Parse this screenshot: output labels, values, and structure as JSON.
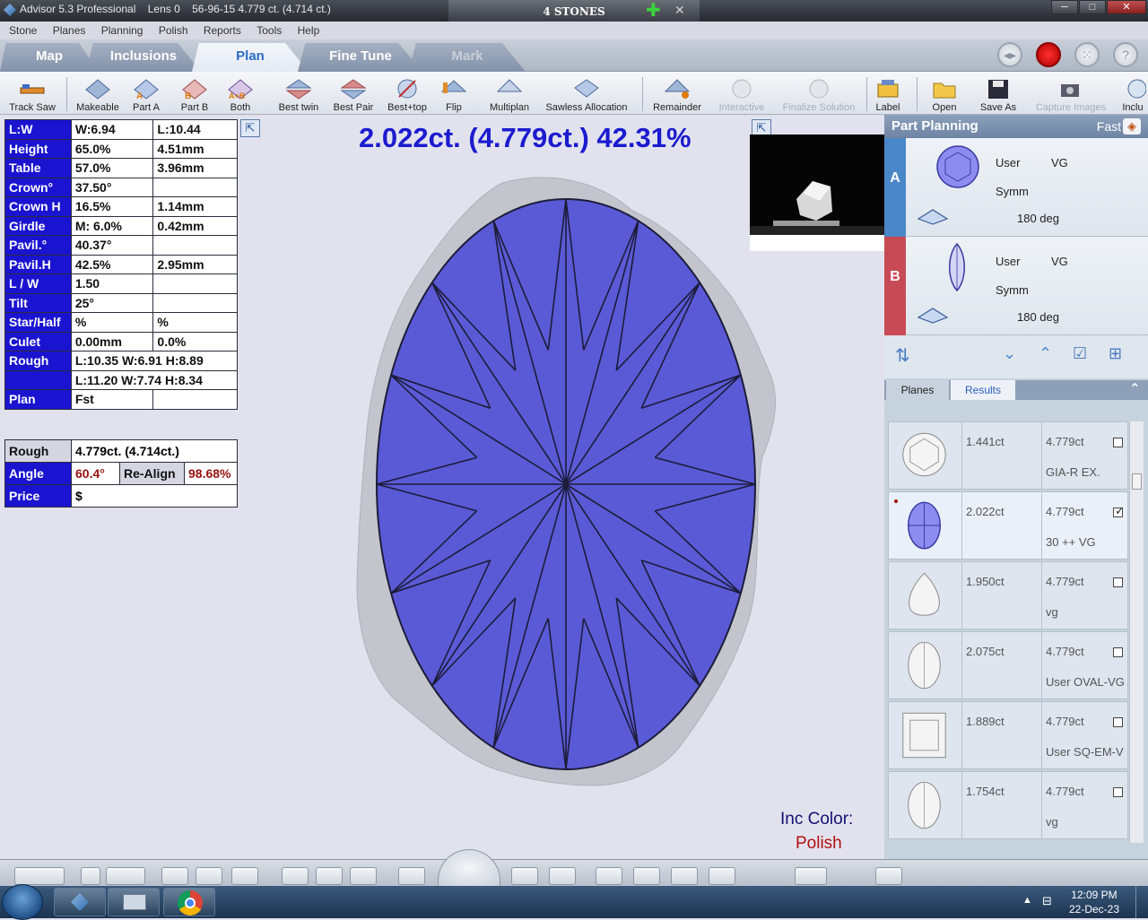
{
  "titlebar": {
    "app_title": "Advisor 5.3 Professional",
    "lens": "Lens 0",
    "info": "56-96-15   4.779 ct. (4.714 ct.)",
    "center_title": "4 STONES",
    "add_symbol": "✚",
    "close_symbol": "✕"
  },
  "menu": [
    "Stone",
    "Planes",
    "Planning",
    "Polish",
    "Reports",
    "Tools",
    "Help"
  ],
  "tabs": [
    "Map",
    "Inclusions",
    "Plan",
    "Fine Tune",
    "Mark"
  ],
  "active_tab": "Plan",
  "toolbar": {
    "items": [
      {
        "label": "Track Saw",
        "icon": "saw-icon"
      },
      {
        "label": "Makeable",
        "icon": "makeable-icon"
      },
      {
        "label": "Part A",
        "icon": "part-a-icon"
      },
      {
        "label": "Part B",
        "icon": "part-b-icon"
      },
      {
        "label": "Both",
        "icon": "both-icon"
      },
      {
        "label": "Best twin",
        "icon": "best-twin-icon"
      },
      {
        "label": "Best Pair",
        "icon": "best-pair-icon"
      },
      {
        "label": "Best+top",
        "icon": "best-top-icon"
      },
      {
        "label": "Flip",
        "icon": "flip-icon"
      },
      {
        "label": "Multiplan",
        "icon": "multiplan-icon"
      },
      {
        "label": "Sawless Allocation",
        "icon": "sawless-icon"
      },
      {
        "label": "Remainder",
        "icon": "remainder-icon"
      },
      {
        "label": "Interactive",
        "icon": "interactive-icon"
      },
      {
        "label": "Finalize Solution",
        "icon": "finalize-icon"
      },
      {
        "label": "Label",
        "icon": "label-icon"
      },
      {
        "label": "Open",
        "icon": "open-folder-icon"
      },
      {
        "label": "Save As",
        "icon": "save-icon"
      },
      {
        "label": "Capture Images",
        "icon": "camera-icon"
      },
      {
        "label": "Inclu",
        "icon": "inclusion-icon"
      }
    ]
  },
  "params": [
    {
      "k": "L:W",
      "v1": "W:6.94",
      "v2": "L:10.44"
    },
    {
      "k": "Height",
      "v1": "65.0%",
      "v2": "4.51mm"
    },
    {
      "k": "Table",
      "v1": "57.0%",
      "v2": "3.96mm"
    },
    {
      "k": "Crown°",
      "v1": "37.50°",
      "v2": ""
    },
    {
      "k": "Crown H",
      "v1": "16.5%",
      "v2": "1.14mm"
    },
    {
      "k": "Girdle",
      "v1": "M: 6.0%",
      "v2": "0.42mm"
    },
    {
      "k": "Pavil.°",
      "v1": "40.37°",
      "v2": ""
    },
    {
      "k": "Pavil.H",
      "v1": "42.5%",
      "v2": "2.95mm"
    },
    {
      "k": "L / W",
      "v1": "1.50",
      "v2": ""
    },
    {
      "k": "Tilt",
      "v1": "25°",
      "v2": ""
    },
    {
      "k": "Star/Half",
      "v1": "%",
      "v2": "%"
    },
    {
      "k": "Culet",
      "v1": "0.00mm",
      "v2": "0.0%"
    },
    {
      "k": "Rough",
      "v1": "L:10.35 W:6.91 H:8.89",
      "v2": ""
    },
    {
      "k": "",
      "v1": "L:11.20 W:7.74 H:8.34",
      "v2": ""
    },
    {
      "k": "Plan",
      "v1": "Fst",
      "v2": ""
    }
  ],
  "summary": {
    "rough_label": "Rough",
    "rough_value": "4.779ct. (4.714ct.)",
    "angle_label": "Angle",
    "angle_value": "60.4°",
    "realign_label": "Re-Align",
    "realign_value": "98.68%",
    "price_label": "Price",
    "price_value": "$"
  },
  "headline": "2.022ct. (4.779ct.) 42.31%",
  "inclusion": {
    "label": "Inc Color:",
    "value": "Polish"
  },
  "part_planning": {
    "title": "Part Planning",
    "mode": "Fast",
    "parts": [
      {
        "id": "A",
        "user": "User",
        "grade": "VG",
        "symm": "Symm",
        "rotation": "180 deg",
        "color": "#4a86c8"
      },
      {
        "id": "B",
        "user": "User",
        "grade": "VG",
        "symm": "Symm",
        "rotation": "180 deg",
        "color": "#c84a55"
      }
    ]
  },
  "result_tabs": [
    "Planes",
    "Results"
  ],
  "active_result_tab": "Results",
  "results": [
    {
      "ct": "1.441ct",
      "rough": "4.779ct",
      "desc": "GIA-R EX.",
      "shape": "round",
      "checked": false
    },
    {
      "ct": "2.022ct",
      "rough": "4.779ct",
      "desc": "30 ++  VG",
      "shape": "oval-blue",
      "checked": true
    },
    {
      "ct": "1.950ct",
      "rough": "4.779ct",
      "desc": "vg",
      "shape": "pear",
      "checked": false
    },
    {
      "ct": "2.075ct",
      "rough": "4.779ct",
      "desc": "User OVAL-VG",
      "shape": "oval",
      "checked": false
    },
    {
      "ct": "1.889ct",
      "rough": "4.779ct",
      "desc": "User SQ-EM-V",
      "shape": "square-emerald",
      "checked": false
    },
    {
      "ct": "1.754ct",
      "rough": "4.779ct",
      "desc": "vg",
      "shape": "oval",
      "checked": false
    }
  ],
  "clock": {
    "time": "12:09 PM",
    "date": "22-Dec-23"
  },
  "colors": {
    "stone_blue": "#5a5ad6",
    "param_key_bg": "#1a14d0",
    "headline": "#1b1bcf"
  }
}
